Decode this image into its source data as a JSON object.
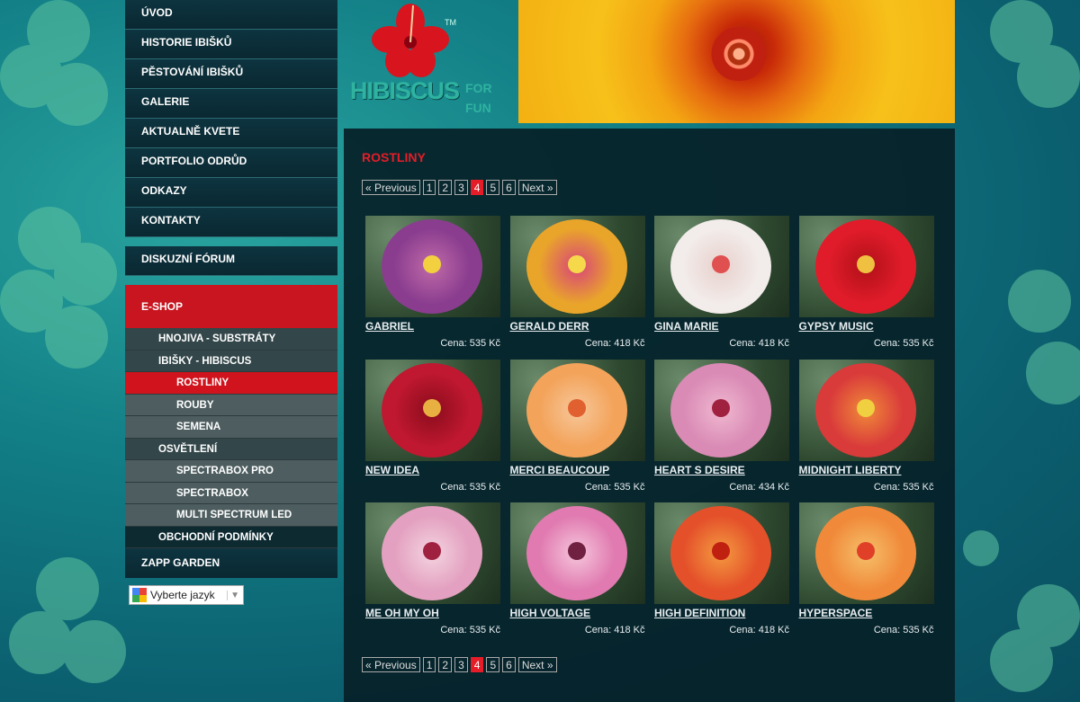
{
  "nav": {
    "items": [
      {
        "label": "ÚVOD"
      },
      {
        "label": "HISTORIE IBIŠKŮ"
      },
      {
        "label": "PĚSTOVÁNÍ IBIŠKŮ"
      },
      {
        "label": "GALERIE"
      },
      {
        "label": "AKTUALNĚ KVETE"
      },
      {
        "label": "PORTFOLIO ODRŮD"
      },
      {
        "label": "ODKAZY"
      },
      {
        "label": "KONTAKTY"
      }
    ],
    "forum": "DISKUZNÍ FÓRUM",
    "eshop": "E-SHOP",
    "sub": {
      "fertilizers": "HNOJIVA - SUBSTRÁTY",
      "hibiscus": "IBIŠKY - HIBISCUS",
      "plants": "ROSTLINY",
      "rootstocks": "ROUBY",
      "seeds": "SEMENA",
      "lighting": "OSVĚTLENÍ",
      "spectrabox_pro": "SPECTRABOX PRO",
      "spectrabox": "SPECTRABOX",
      "multi_led": "MULTI SPECTRUM LED",
      "terms": "OBCHODNÍ PODMÍNKY"
    },
    "zapp": "ZAPP GARDEN",
    "language_select": "Vyberte jazyk"
  },
  "header": {
    "logo_main": "HIBISCUS",
    "logo_for": "FOR",
    "logo_fun": "FUN",
    "logo_tm": "TM"
  },
  "content": {
    "title": "ROSTLINY",
    "pager": {
      "prev": "« Previous",
      "pages": [
        "1",
        "2",
        "3",
        "4",
        "5",
        "6"
      ],
      "current": "4",
      "next": "Next »"
    },
    "products": [
      {
        "name": "GABRIEL",
        "price": "Cena: 535 Kč",
        "colors": [
          "#8a3d8f",
          "#c06aa8",
          "#f2d040"
        ]
      },
      {
        "name": "GERALD DERR",
        "price": "Cena: 418 Kč",
        "colors": [
          "#e9a52a",
          "#d8447a",
          "#f6d94a"
        ]
      },
      {
        "name": "GINA MARIE",
        "price": "Cena: 418 Kč",
        "colors": [
          "#f2ecea",
          "#e8d0cc",
          "#e05050"
        ]
      },
      {
        "name": "GYPSY MUSIC",
        "price": "Cena: 535 Kč",
        "colors": [
          "#e11c2a",
          "#b01018",
          "#f0c040"
        ]
      },
      {
        "name": "NEW IDEA",
        "price": "Cena: 535 Kč",
        "colors": [
          "#c01830",
          "#8a0c1c",
          "#e8b040"
        ]
      },
      {
        "name": "MERCI BEAUCOUP",
        "price": "Cena: 535 Kč",
        "colors": [
          "#f3a35a",
          "#f7c79a",
          "#e06030"
        ]
      },
      {
        "name": "HEART S DESIRE",
        "price": "Cena: 434 Kč",
        "colors": [
          "#d98ab5",
          "#f0b8d0",
          "#a02040"
        ]
      },
      {
        "name": "MIDNIGHT LIBERTY",
        "price": "Cena: 535 Kč",
        "colors": [
          "#d93a3a",
          "#f08a3a",
          "#f0d040"
        ]
      },
      {
        "name": "ME OH MY OH",
        "price": "Cena: 535 Kč",
        "colors": [
          "#e3a0c0",
          "#f4d4e0",
          "#a02040"
        ]
      },
      {
        "name": "HIGH VOLTAGE",
        "price": "Cena: 418 Kč",
        "colors": [
          "#e07ab0",
          "#f6c6dc",
          "#702040"
        ]
      },
      {
        "name": "HIGH DEFINITION",
        "price": "Cena: 418 Kč",
        "colors": [
          "#e4502a",
          "#f49a40",
          "#c02010"
        ]
      },
      {
        "name": "HYPERSPACE",
        "price": "Cena: 535 Kč",
        "colors": [
          "#f08a3a",
          "#f6c06a",
          "#e04028"
        ]
      }
    ]
  }
}
